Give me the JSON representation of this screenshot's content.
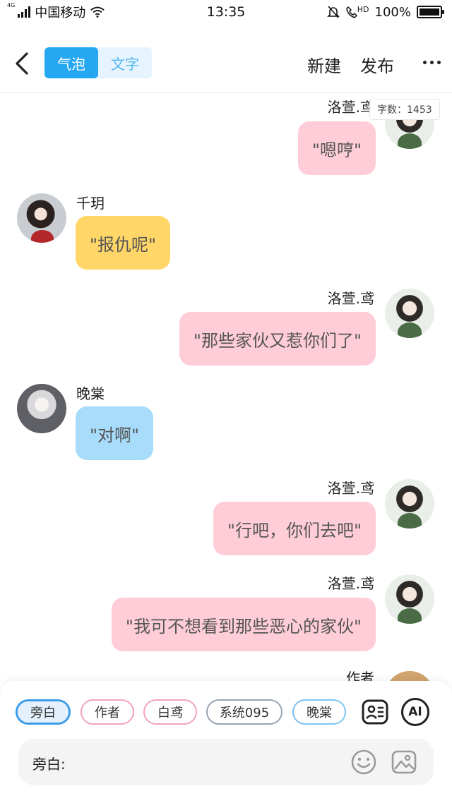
{
  "status": {
    "network": "4G",
    "carrier": "中国移动",
    "time": "13:35",
    "hd": "HD",
    "battery": "100%"
  },
  "header": {
    "tabs": [
      {
        "label": "气泡",
        "active": true
      },
      {
        "label": "文字",
        "active": false
      }
    ],
    "new_label": "新建",
    "publish_label": "发布"
  },
  "word_count": "字数：1453",
  "messages": [
    {
      "name": "洛萱.鸢",
      "text": "\"嗯哼\"",
      "side": "right",
      "color": "#ffcdd8"
    },
    {
      "name": "千玥",
      "text": "\"报仇呢\"",
      "side": "left",
      "color": "#ffd667"
    },
    {
      "name": "洛萱.鸢",
      "text": "\"那些家伙又惹你们了\"",
      "side": "right",
      "color": "#ffcdd8"
    },
    {
      "name": "晚棠",
      "text": "\"对啊\"",
      "side": "left",
      "color": "#a8dcfb"
    },
    {
      "name": "洛萱.鸢",
      "text": "\"行吧，你们去吧\"",
      "side": "right",
      "color": "#ffcdd8"
    },
    {
      "name": "洛萱.鸢",
      "text": "\"我可不想看到那些恶心的家伙\"",
      "side": "right",
      "color": "#ffcdd8"
    },
    {
      "name": "作者",
      "text": "",
      "side": "right",
      "color": "#ffcdd8"
    }
  ],
  "roles": [
    {
      "label": "旁白",
      "active": true
    },
    {
      "label": "作者",
      "active": false
    },
    {
      "label": "白鸢",
      "active": false
    },
    {
      "label": "系统095",
      "active": false
    },
    {
      "label": "晚棠",
      "active": false
    }
  ],
  "ai_label": "AI",
  "input": {
    "label": "旁白:"
  },
  "icons": [
    "back-icon",
    "wifi-icon",
    "mute-icon",
    "hd-call-icon",
    "battery-icon",
    "more-icon",
    "contact-card-icon",
    "ai-icon",
    "emoji-icon",
    "image-icon"
  ]
}
